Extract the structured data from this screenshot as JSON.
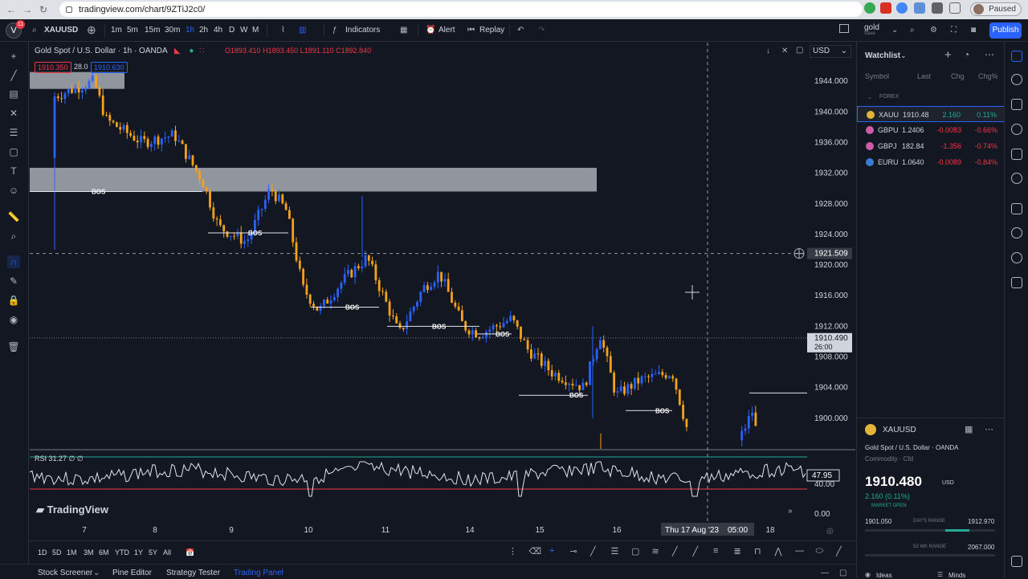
{
  "browser": {
    "url": "tradingview.com/chart/9ZTiJ2c0/",
    "paused_label": "Paused"
  },
  "toolbar": {
    "user_initial": "V",
    "notif_count": "11",
    "symbol": "XAUUSD",
    "intervals": [
      "1m",
      "5m",
      "15m",
      "30m",
      "1h",
      "2h",
      "4h",
      "D",
      "W",
      "M"
    ],
    "active_interval": "1h",
    "indicators_label": "Indicators",
    "alert_label": "Alert",
    "replay_label": "Replay",
    "layout_name": "gold",
    "layout_sub": "Save",
    "publish_label": "Publish"
  },
  "chart": {
    "title": "Gold Spot / U.S. Dollar · 1h · OANDA",
    "ohlc": {
      "o": "O1893.410",
      "h": "H1893.450",
      "l": "L1891.110",
      "c": "C1892.840"
    },
    "bid": "1910.350",
    "spread": "28.0",
    "ask": "1910.630",
    "currency": "USD",
    "price_ticks": [
      "1944.000",
      "1940.000",
      "1936.000",
      "1932.000",
      "1928.000",
      "1924.000",
      "1920.000",
      "1916.000",
      "1912.000",
      "1908.000",
      "1904.000",
      "1900.000"
    ],
    "crosshair_price": "1921.509",
    "last_price": "1910.490",
    "countdown": "26:00",
    "bos_label": "BOS",
    "date_ticks": [
      "7",
      "8",
      "9",
      "10",
      "11",
      "14",
      "15",
      "16",
      "18"
    ],
    "crosshair_date": "Thu 17 Aug '23",
    "crosshair_time": "05:00",
    "rsi_label": "RSI 31.27 ∅ ∅",
    "rsi_value": "47.95",
    "rsi_level": "40.00",
    "rsi_zero": "0.00",
    "brand": "TradingView",
    "timeframes": [
      "1D",
      "5D",
      "1M",
      "3M",
      "6M",
      "YTD",
      "1Y",
      "5Y",
      "All"
    ]
  },
  "panels": [
    "Stock Screener",
    "Pine Editor",
    "Strategy Tester",
    "Trading Panel"
  ],
  "watchlist": {
    "title": "Watchlist",
    "columns": [
      "Symbol",
      "Last",
      "Chg",
      "Chg%"
    ],
    "group": "FOREX",
    "rows": [
      {
        "symbol": "XAUU",
        "last": "1910.48",
        "chg": "2.160",
        "chgp": "0.11%",
        "color": "#e2b53a",
        "up": true
      },
      {
        "symbol": "GBPU",
        "last": "1.2406",
        "chg": "-0.0083",
        "chgp": "-0.66%",
        "color": "#cf5aa8",
        "up": false
      },
      {
        "symbol": "GBPJ",
        "last": "182.84",
        "chg": "-1.356",
        "chgp": "-0.74%",
        "color": "#cf5aa8",
        "up": false
      },
      {
        "symbol": "EURU",
        "last": "1.0640",
        "chg": "-0.0089",
        "chgp": "-0.84%",
        "color": "#3a7bd5",
        "up": false
      }
    ]
  },
  "details": {
    "symbol": "XAUUSD",
    "name": "Gold Spot / U.S. Dollar · OANDA",
    "category": "Commodity · Cfd",
    "price": "1910.480",
    "currency": "USD",
    "change": "2.160 (0.11%)",
    "status": "MARKET OPEN",
    "range_low": "1901.050",
    "range_label": "DAY'S RANGE",
    "range_high": "1912.970",
    "range2_label": "52 WK RANGE",
    "range2_high": "2067.000",
    "ideas_label": "Ideas",
    "minds_label": "Minds"
  }
}
